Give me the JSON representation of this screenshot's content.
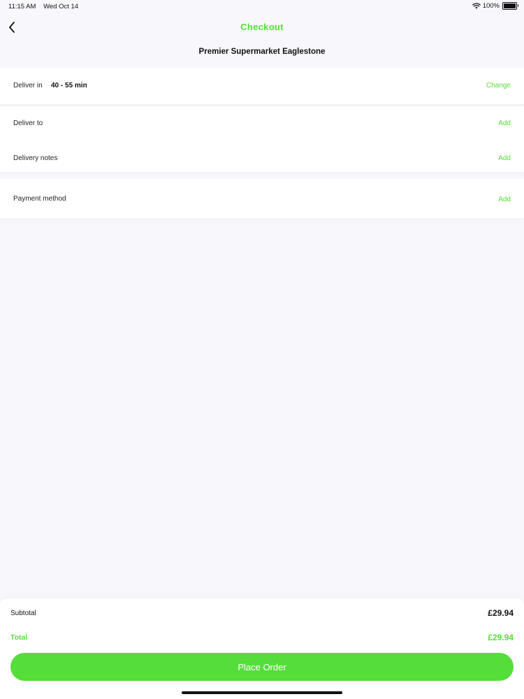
{
  "status_bar": {
    "time": "11:15 AM",
    "date": "Wed Oct 14",
    "battery_percent": "100%",
    "battery_level": 1.0
  },
  "nav": {
    "title": "Checkout",
    "accent_color": "#55dd3a"
  },
  "store": {
    "name": "Premier Supermarket Eaglestone"
  },
  "delivery": {
    "deliver_in_label": "Deliver in",
    "deliver_in_value": "40 - 55 min",
    "deliver_in_action": "Change",
    "deliver_to_label": "Deliver to",
    "deliver_to_action": "Add",
    "notes_label": "Delivery notes",
    "notes_action": "Add"
  },
  "payment": {
    "label": "Payment method",
    "action": "Add"
  },
  "summary": {
    "subtotal_label": "Subtotal",
    "subtotal_amount": "£29.94",
    "total_label": "Total",
    "total_amount": "£29.94",
    "place_order_label": "Place Order"
  },
  "icons": {
    "back": "chevron-left-icon",
    "wifi": "wifi-icon",
    "battery": "battery-icon"
  }
}
